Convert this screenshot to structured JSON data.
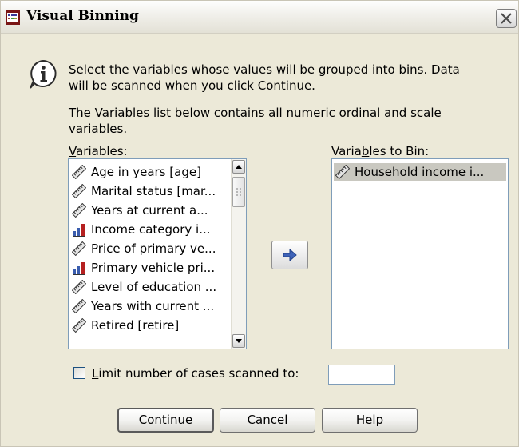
{
  "window": {
    "title": "Visual Binning"
  },
  "info": {
    "line1": "Select the variables whose values will be grouped into bins. Data",
    "line2": "will be scanned when you click Continue.",
    "line3": "The Variables list below contains all numeric ordinal and scale",
    "line4": "variables."
  },
  "variables": {
    "label_first": "V",
    "label_rest": "ariables:",
    "items": [
      {
        "label": "Age in years [age]",
        "icon": "scale-ruler-icon"
      },
      {
        "label": "Marital status [mar...",
        "icon": "scale-ruler-icon"
      },
      {
        "label": "Years at current a...",
        "icon": "scale-ruler-icon"
      },
      {
        "label": "Income category i...",
        "icon": "ordinal-bars-icon"
      },
      {
        "label": "Price of primary ve...",
        "icon": "scale-ruler-icon"
      },
      {
        "label": "Primary vehicle pri...",
        "icon": "ordinal-bars-icon"
      },
      {
        "label": "Level of education ...",
        "icon": "scale-ruler-icon"
      },
      {
        "label": "Years with current ...",
        "icon": "scale-ruler-icon"
      },
      {
        "label": "Retired [retire]",
        "icon": "scale-ruler-icon"
      }
    ]
  },
  "bin": {
    "label_pre": "Varia",
    "label_u": "b",
    "label_post": "les to Bin:",
    "items": [
      {
        "label": "Household income i...",
        "icon": "scale-ruler-icon"
      }
    ]
  },
  "limit": {
    "label_u": "L",
    "label_rest": "imit number of cases scanned to:",
    "checked": false,
    "value": ""
  },
  "buttons": {
    "continue": "Continue",
    "cancel": "Cancel",
    "help": "Help"
  },
  "colors": {
    "selection": "#c9c8c0",
    "list_border": "#7f9db9",
    "dialog_bg": "#ece9d8"
  }
}
